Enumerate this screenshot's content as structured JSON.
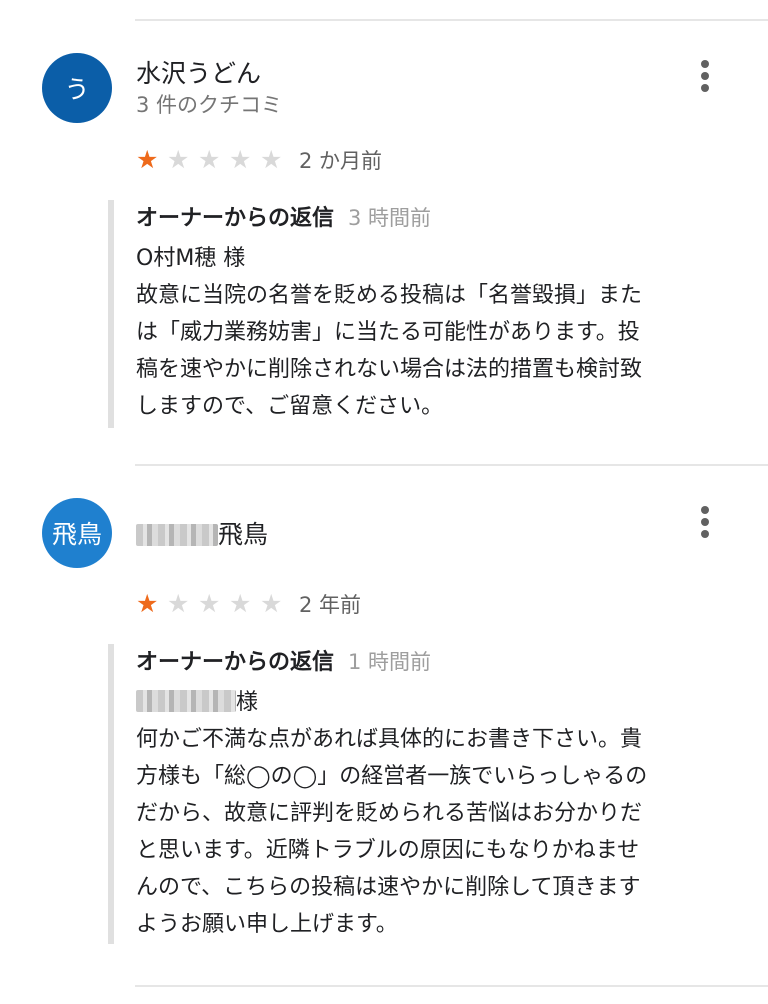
{
  "reviews": [
    {
      "avatar_text": "う",
      "avatar_color": "#0b5ea8",
      "name": "水沢うどん",
      "review_count": "3 件のクチコミ",
      "stars_filled": 1,
      "stars_total": 5,
      "time": "2 か月前",
      "reply": {
        "label": "オーナーからの返信",
        "time": "3 時間前",
        "lines": [
          "O村M穂 様",
          "故意に当院の名誉を貶める投稿は「名誉毀損」また",
          "は「威力業務妨害」に当たる可能性があります。投",
          "稿を速やかに削除されない場合は法的措置も検討致",
          "しますので、ご留意ください。"
        ]
      }
    },
    {
      "avatar_text": "飛鳥",
      "avatar_color": "#1f80cf",
      "name_visible": "飛鳥",
      "stars_filled": 1,
      "stars_total": 5,
      "time": "2 年前",
      "reply": {
        "label": "オーナーからの返信",
        "time": "1 時間前",
        "salutation_visible": "様",
        "lines": [
          "何かご不満な点があれば具体的にお書き下さい。貴",
          "方様も「総◯の◯」の経営者一族でいらっしゃるの",
          "だから、故意に評判を貶められる苦悩はお分かりだ",
          "と思います。近隣トラブルの原因にもなりかねませ",
          "んので、こちらの投稿は速やかに削除して頂きます",
          "ようお願い申し上げます。"
        ]
      }
    }
  ],
  "icons": {
    "more": "more-vert-icon",
    "star": "star-icon"
  },
  "colors": {
    "star_on": "#ee6a1b",
    "star_off": "#d9d9d9"
  }
}
